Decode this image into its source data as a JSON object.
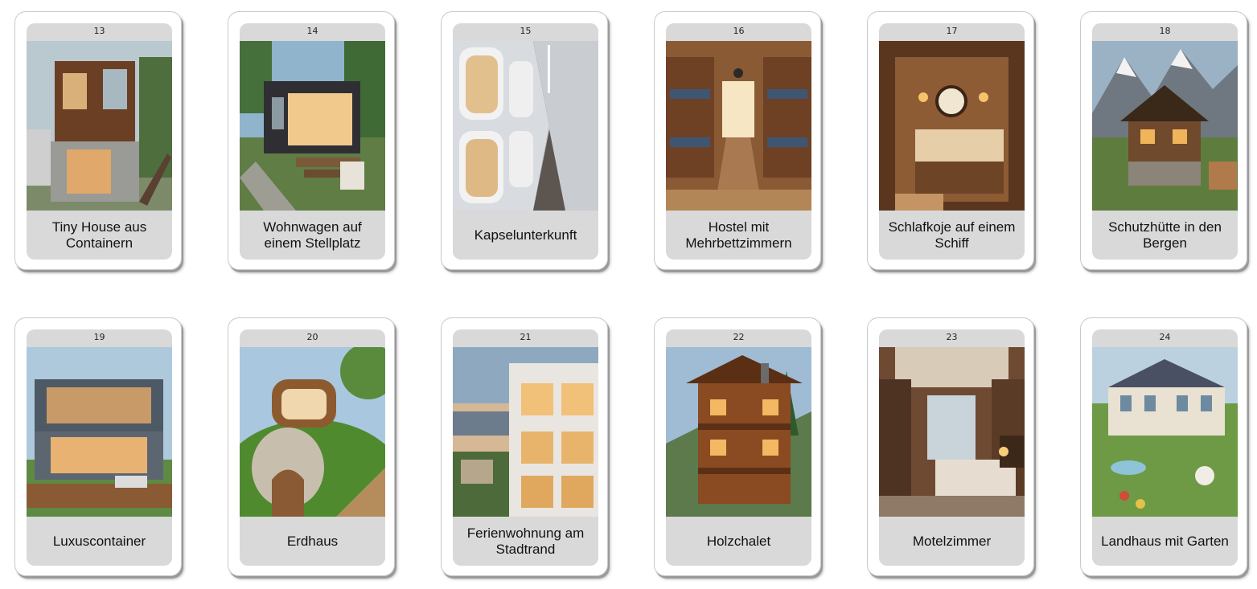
{
  "cards": [
    {
      "number": "13",
      "label": "Tiny House aus Containern",
      "image": "container-tiny-house-image"
    },
    {
      "number": "14",
      "label": "Wohnwagen auf einem Stellplatz",
      "image": "caravan-image"
    },
    {
      "number": "15",
      "label": "Kapselunterkunft",
      "image": "capsule-hotel-image"
    },
    {
      "number": "16",
      "label": "Hostel mit Mehrbettzimmern",
      "image": "hostel-dorm-image"
    },
    {
      "number": "17",
      "label": "Schlafkoje auf einem Schiff",
      "image": "ship-berth-image"
    },
    {
      "number": "18",
      "label": "Schutzhütte in den Bergen",
      "image": "mountain-hut-image"
    },
    {
      "number": "19",
      "label": "Luxuscontainer",
      "image": "luxury-container-image"
    },
    {
      "number": "20",
      "label": "Erdhaus",
      "image": "earth-house-image"
    },
    {
      "number": "21",
      "label": "Ferienwohnung am Stadtrand",
      "image": "holiday-apartment-image"
    },
    {
      "number": "22",
      "label": "Holzchalet",
      "image": "wooden-chalet-image"
    },
    {
      "number": "23",
      "label": "Motelzimmer",
      "image": "motel-room-image"
    },
    {
      "number": "24",
      "label": "Landhaus mit Garten",
      "image": "country-house-image"
    }
  ]
}
